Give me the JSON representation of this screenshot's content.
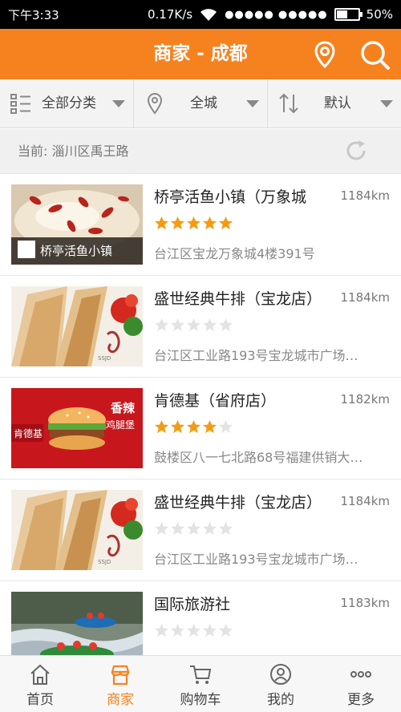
{
  "status_bar": {
    "time": "下午3:33",
    "speed": "0.17K/s",
    "battery": "50%",
    "battery_level": 0.5
  },
  "header": {
    "title": "商家 - 成都"
  },
  "filters": [
    {
      "label": "全部分类"
    },
    {
      "label": "全城"
    },
    {
      "label": "默认"
    }
  ],
  "current_location": {
    "text": "当前: 淄川区禹王路"
  },
  "merchants": [
    {
      "name": "桥亭活鱼小镇（万象城",
      "distance": "1184km",
      "rating": 5,
      "address": "台江区宝龙万象城4楼391号",
      "thumb": "fish"
    },
    {
      "name": "盛世经典牛排（宝龙店）",
      "distance": "1184km",
      "rating": 0,
      "address": "台江区工业路193号宝龙城市广场…",
      "thumb": "steak"
    },
    {
      "name": "肯德基（省府店）",
      "distance": "1182km",
      "rating": 4,
      "address": "鼓楼区八一七北路68号福建供销大…",
      "thumb": "kfc"
    },
    {
      "name": "盛世经典牛排（宝龙店）",
      "distance": "1184km",
      "rating": 0,
      "address": "台江区工业路193号宝龙城市广场…",
      "thumb": "steak"
    },
    {
      "name": "国际旅游社",
      "distance": "1183km",
      "rating": 0,
      "address": "",
      "thumb": "rafting"
    }
  ],
  "tabs": [
    {
      "label": "首页",
      "icon": "home-icon",
      "active": false
    },
    {
      "label": "商家",
      "icon": "shop-icon",
      "active": true
    },
    {
      "label": "购物车",
      "icon": "cart-icon",
      "active": false
    },
    {
      "label": "我的",
      "icon": "user-icon",
      "active": false
    },
    {
      "label": "更多",
      "icon": "more-icon",
      "active": false
    }
  ],
  "colors": {
    "accent": "#f5821f",
    "star_on": "#f39c12",
    "star_off": "#e3e3e3"
  }
}
